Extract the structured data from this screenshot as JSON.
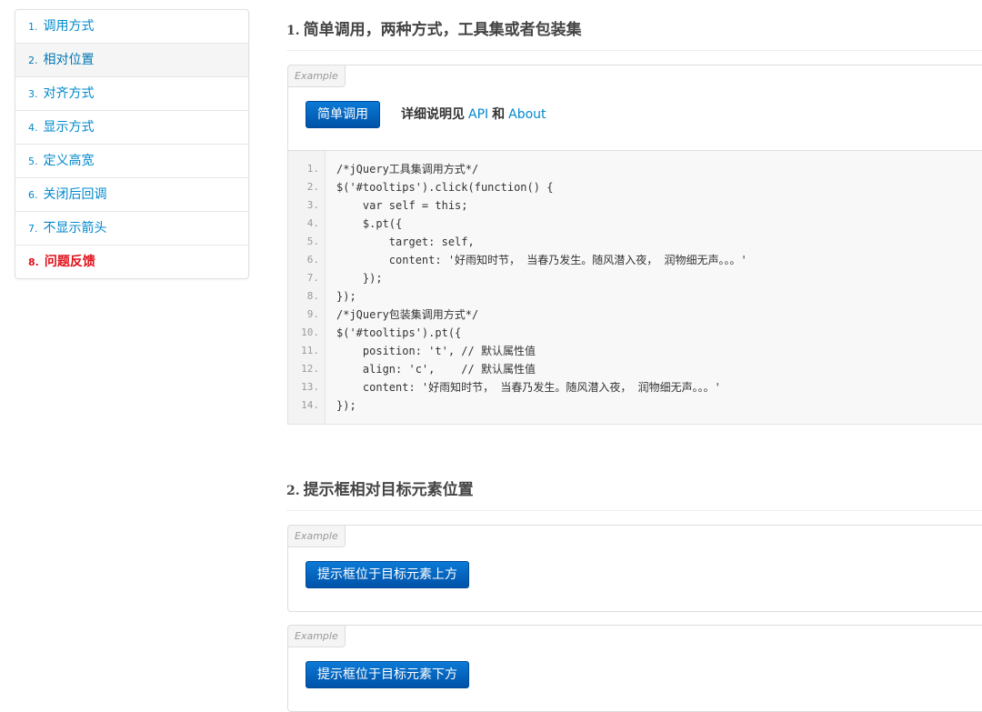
{
  "sidebar": {
    "items": [
      {
        "num": "1.",
        "label": "调用方式"
      },
      {
        "num": "2.",
        "label": "相对位置"
      },
      {
        "num": "3.",
        "label": "对齐方式"
      },
      {
        "num": "4.",
        "label": "显示方式"
      },
      {
        "num": "5.",
        "label": "定义高宽"
      },
      {
        "num": "6.",
        "label": "关闭后回调"
      },
      {
        "num": "7.",
        "label": "不显示箭头"
      },
      {
        "num": "8.",
        "label": "问题反馈"
      }
    ]
  },
  "section1": {
    "num": "1.",
    "title": "简单调用，两种方式，工具集或者包装集",
    "example_tag": "Example",
    "button_label": "简单调用",
    "desc_prefix": "详细说明见",
    "link_api": "API",
    "desc_and": "和",
    "link_about": "About"
  },
  "code": {
    "lines": [
      {
        "n": "1.",
        "t": "/*jQuery工具集调用方式*/"
      },
      {
        "n": "2.",
        "t": "$('#tooltips').click(function() {"
      },
      {
        "n": "3.",
        "t": "    var self = this;"
      },
      {
        "n": "4.",
        "t": "    $.pt({"
      },
      {
        "n": "5.",
        "t": "        target: self,"
      },
      {
        "n": "6.",
        "t": "        content: '好雨知时节， 当春乃发生。随风潜入夜， 润物细无声。。。'"
      },
      {
        "n": "7.",
        "t": "    });"
      },
      {
        "n": "8.",
        "t": "});"
      },
      {
        "n": "9.",
        "t": "/*jQuery包装集调用方式*/"
      },
      {
        "n": "10.",
        "t": "$('#tooltips').pt({"
      },
      {
        "n": "11.",
        "t": "    position: 't', // 默认属性值"
      },
      {
        "n": "12.",
        "t": "    align: 'c',    // 默认属性值"
      },
      {
        "n": "13.",
        "t": "    content: '好雨知时节， 当春乃发生。随风潜入夜， 润物细无声。。。'"
      },
      {
        "n": "14.",
        "t": "});"
      }
    ]
  },
  "section2": {
    "num": "2.",
    "title": "提示框相对目标元素位置",
    "example_tag": "Example",
    "button_top_label": "提示框位于目标元素上方",
    "button_bottom_label": "提示框位于目标元素下方"
  },
  "colors": {
    "link": "#0088cc",
    "danger": "#e0101a",
    "button": "#0065c2"
  }
}
